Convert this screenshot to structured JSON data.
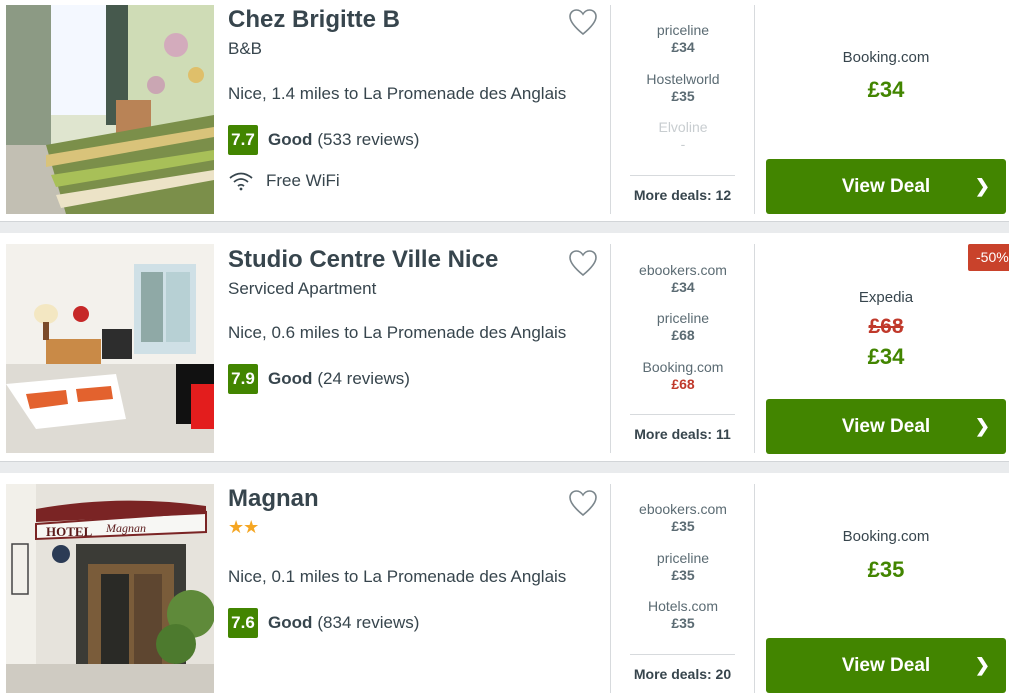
{
  "listings": [
    {
      "name": "Chez Brigitte B",
      "type": "B&B",
      "location": "Nice, 1.4 miles to La Promenade des Anglais",
      "score": "7.7",
      "rating_label": "Good",
      "reviews": "(533 reviews)",
      "amenity": "Free WiFi",
      "deals": [
        {
          "site": "priceline",
          "price": "£34"
        },
        {
          "site": "Hostelworld",
          "price": "£35"
        },
        {
          "site": "Elvoline",
          "price": "-"
        }
      ],
      "more_deals": "More deals: 12",
      "best_provider": "Booking.com",
      "best_price": "£34",
      "cta": "View Deal"
    },
    {
      "name": "Studio Centre Ville Nice",
      "type": "Serviced Apartment",
      "location": "Nice, 0.6 miles to La Promenade des Anglais",
      "score": "7.9",
      "rating_label": "Good",
      "reviews": "(24 reviews)",
      "deals": [
        {
          "site": "ebookers.com",
          "price": "£34"
        },
        {
          "site": "priceline",
          "price": "£68"
        },
        {
          "site": "Booking.com",
          "price": "£68"
        }
      ],
      "more_deals": "More deals: 11",
      "discount_badge": "-50%",
      "best_provider": "Expedia",
      "old_price": "£68",
      "best_price": "£34",
      "cta": "View Deal"
    },
    {
      "name": "Magnan",
      "stars": "★★",
      "location": "Nice, 0.1 miles to La Promenade des Anglais",
      "score": "7.6",
      "rating_label": "Good",
      "reviews": "(834 reviews)",
      "photo_sign": "HOTEL Magnan",
      "deals": [
        {
          "site": "ebookers.com",
          "price": "£35"
        },
        {
          "site": "priceline",
          "price": "£35"
        },
        {
          "site": "Hotels.com",
          "price": "£35"
        }
      ],
      "more_deals": "More deals: 20",
      "best_provider": "Booking.com",
      "best_price": "£35",
      "cta": "View Deal"
    }
  ],
  "colors": {
    "accent_green": "#428500",
    "discount_red": "#c9422b",
    "star_gold": "#f5a623"
  },
  "icons": {
    "favorite": "heart-outline-icon",
    "wifi": "wifi-icon",
    "chevron": "chevron-right-icon"
  }
}
